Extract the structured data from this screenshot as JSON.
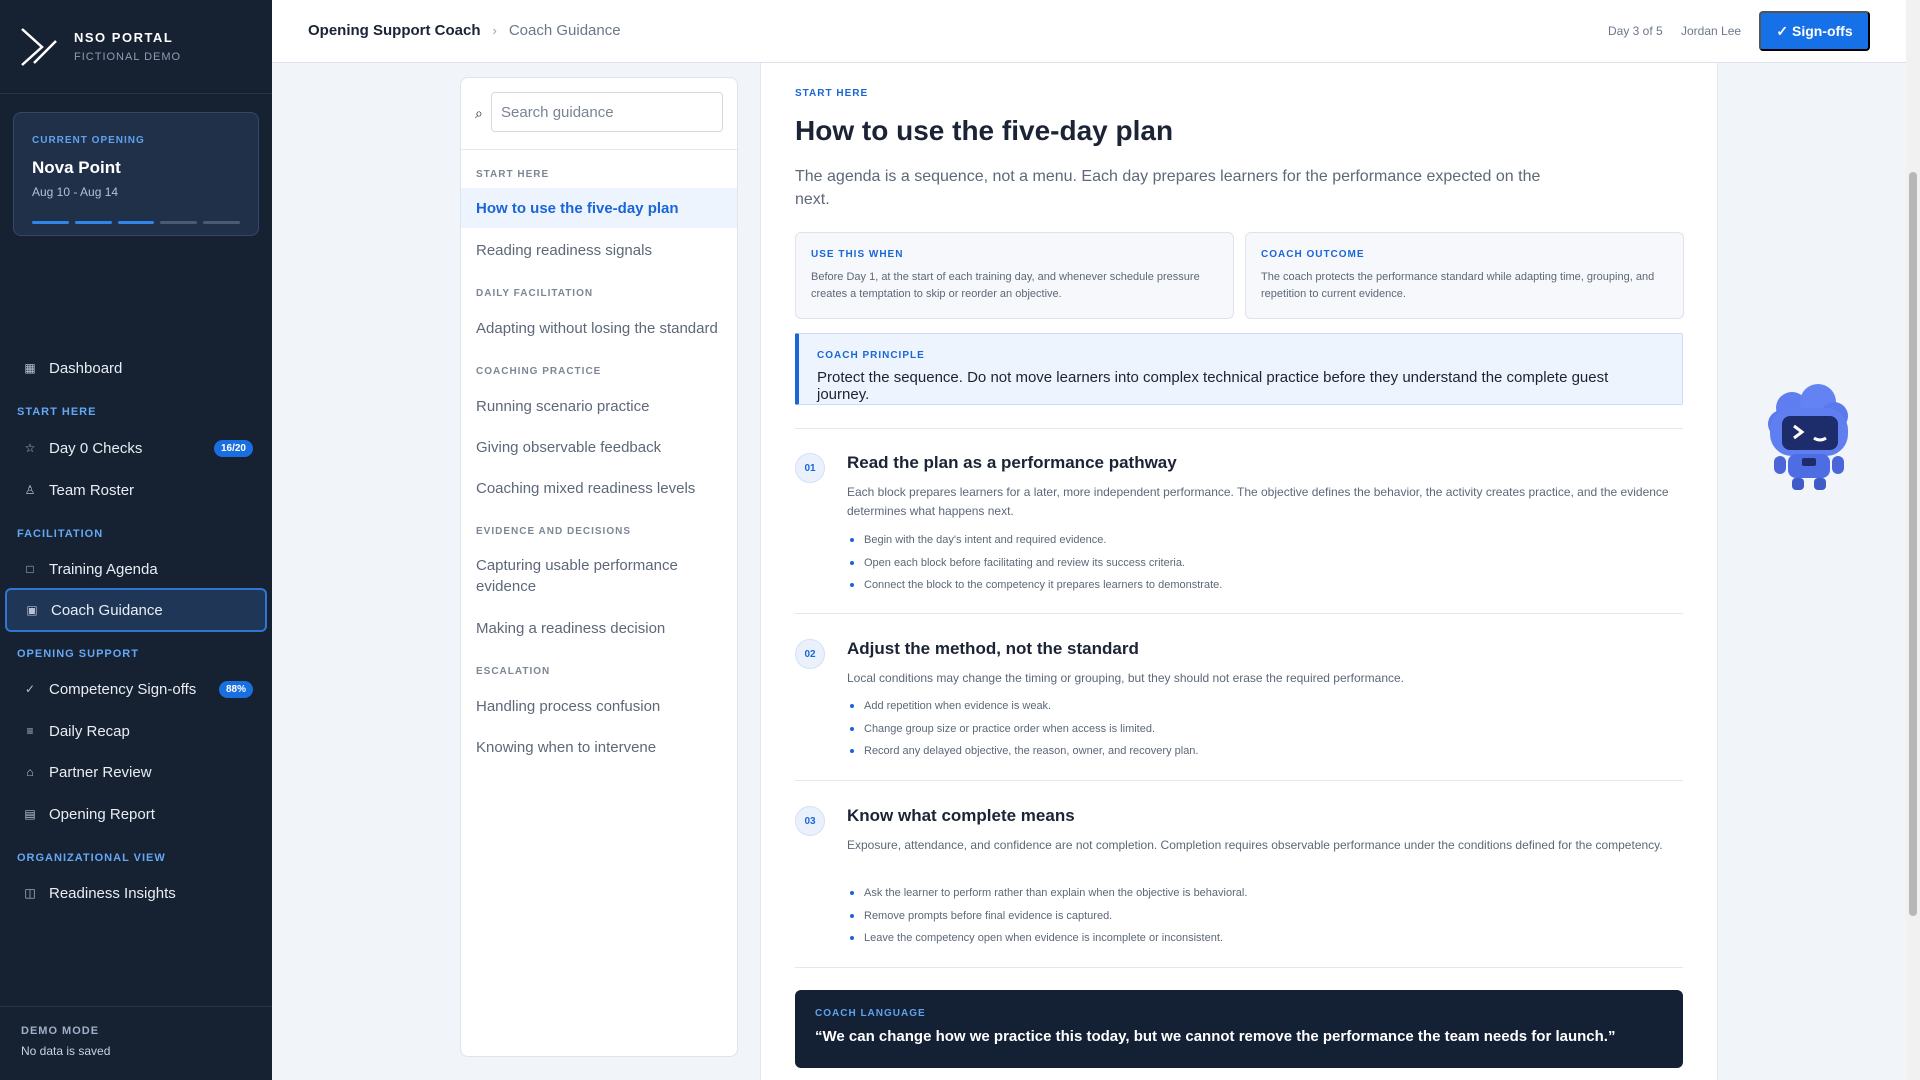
{
  "brand": {
    "name": "NSO PORTAL",
    "subtitle": "FICTIONAL DEMO"
  },
  "opening": {
    "label": "CURRENT OPENING",
    "name": "Nova Point",
    "dates": "Aug 10 - Aug 14",
    "days_total": 5,
    "days_complete": 3
  },
  "nav": {
    "dashboard": "Dashboard",
    "section_start": "START HERE",
    "day0": "Day 0 Checks",
    "day0_badge": "16/20",
    "roster": "Team Roster",
    "section_facilitation": "FACILITATION",
    "agenda": "Training Agenda",
    "guidance": "Coach Guidance",
    "section_support": "OPENING SUPPORT",
    "signoffs": "Competency Sign-offs",
    "signoffs_badge": "88%",
    "recap": "Daily Recap",
    "partner": "Partner Review",
    "report": "Opening Report",
    "section_org": "ORGANIZATIONAL VIEW",
    "insights": "Readiness Insights"
  },
  "demo": {
    "label": "DEMO MODE",
    "text": "No data is saved"
  },
  "topbar": {
    "crumb_parent": "Opening Support Coach",
    "crumb_sep": "›",
    "crumb_current": "Coach Guidance",
    "day": "Day 3 of 5",
    "user": "Jordan Lee",
    "button": "✓ Sign-offs"
  },
  "guide": {
    "search_placeholder": "Search guidance",
    "sections": {
      "start": "START HERE",
      "daily": "DAILY FACILITATION",
      "coaching": "COACHING PRACTICE",
      "evidence": "EVIDENCE AND DECISIONS",
      "escalation": "ESCALATION"
    },
    "items": [
      "How to use the five-day plan",
      "Reading readiness signals",
      "Adapting without losing the standard",
      "Running scenario practice",
      "Giving observable feedback",
      "Coaching mixed readiness levels",
      "Capturing usable performance evidence",
      "Making a readiness decision",
      "Handling process confusion",
      "Knowing when to intervene"
    ]
  },
  "article": {
    "eyebrow": "START HERE",
    "title": "How to use the five-day plan",
    "lead": "The agenda is a sequence, not a menu. Each day prepares learners for the performance expected on the next.",
    "use_when": {
      "label": "USE THIS WHEN",
      "text": "Before Day 1, at the start of each training day, and whenever schedule pressure creates a temptation to skip or reorder an objective."
    },
    "outcome": {
      "label": "COACH OUTCOME",
      "text": "The coach protects the performance standard while adapting time, grouping, and repetition to current evidence."
    },
    "principle": {
      "label": "COACH PRINCIPLE",
      "text": "Protect the sequence. Do not move learners into complex technical practice before they understand the complete guest journey."
    },
    "steps": [
      {
        "num": "01",
        "title": "Read the plan as a performance pathway",
        "body": "Each block prepares learners for a later, more independent performance. The objective defines the behavior, the activity creates practice, and the evidence determines what happens next.",
        "bullets": [
          "Begin with the day's intent and required evidence.",
          "Open each block before facilitating and review its success criteria.",
          "Connect the block to the competency it prepares learners to demonstrate."
        ]
      },
      {
        "num": "02",
        "title": "Adjust the method, not the standard",
        "body": "Local conditions may change the timing or grouping, but they should not erase the required performance.",
        "bullets": [
          "Add repetition when evidence is weak.",
          "Change group size or practice order when access is limited.",
          "Record any delayed objective, the reason, owner, and recovery plan."
        ]
      },
      {
        "num": "03",
        "title": "Know what complete means",
        "body": "Exposure, attendance, and confidence are not completion. Completion requires observable performance under the conditions defined for the competency.",
        "bullets": [
          "Ask the learner to perform rather than explain when the objective is behavioral.",
          "Remove prompts before final evidence is captured.",
          "Leave the competency open when evidence is incomplete or inconsistent."
        ]
      }
    ],
    "language": {
      "label": "COACH LANGUAGE",
      "text": "“We can change how we practice this today, but we cannot remove the performance the team needs for launch.”"
    }
  },
  "icons": {
    "dashboard": "grid-icon",
    "day0": "star-icon",
    "roster": "person-icon",
    "agenda": "square-icon",
    "guidance": "book-icon",
    "signoffs": "check-icon",
    "recap": "list-icon",
    "partner": "home-icon",
    "report": "report-icon",
    "insights": "columns-icon"
  },
  "colors": {
    "accent": "#1a66d6",
    "button": "#1671e8",
    "sidebar": "#162132",
    "dark_panel": "#142034"
  }
}
